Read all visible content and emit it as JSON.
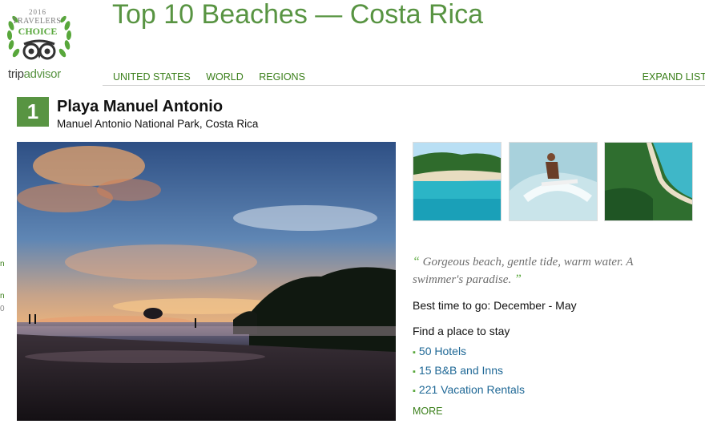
{
  "badge": {
    "year": "2016",
    "line1": "TRAVELERS'",
    "line2": "CHOICE",
    "brand_a": "trip",
    "brand_b": "advisor",
    "icon": "owl-eyes-icon",
    "colors": {
      "green": "#589442",
      "grey": "#7b7b7b"
    }
  },
  "header": {
    "title": "Top 10 Beaches — Costa Rica",
    "nav": [
      "UNITED STATES",
      "WORLD",
      "REGIONS"
    ],
    "expand": "EXPAND LIST"
  },
  "beach": {
    "rank": "1",
    "name": "Playa Manuel Antonio",
    "location": "Manuel Antonio National Park, Costa Rica",
    "quote": "Gorgeous beach, gentle tide, warm water. A swimmer's paradise.",
    "quote_open": "“",
    "quote_close": "”",
    "best_time": "Best time to go: December - May",
    "stay_heading": "Find a place to stay",
    "stay_options": [
      "50 Hotels",
      "15 B&B and Inns",
      "221 Vacation Rentals"
    ],
    "more": "MORE"
  },
  "edge_fragments": [
    "n",
    "n",
    "0"
  ],
  "accent_color": "#589442",
  "link_color": "#1f6896"
}
